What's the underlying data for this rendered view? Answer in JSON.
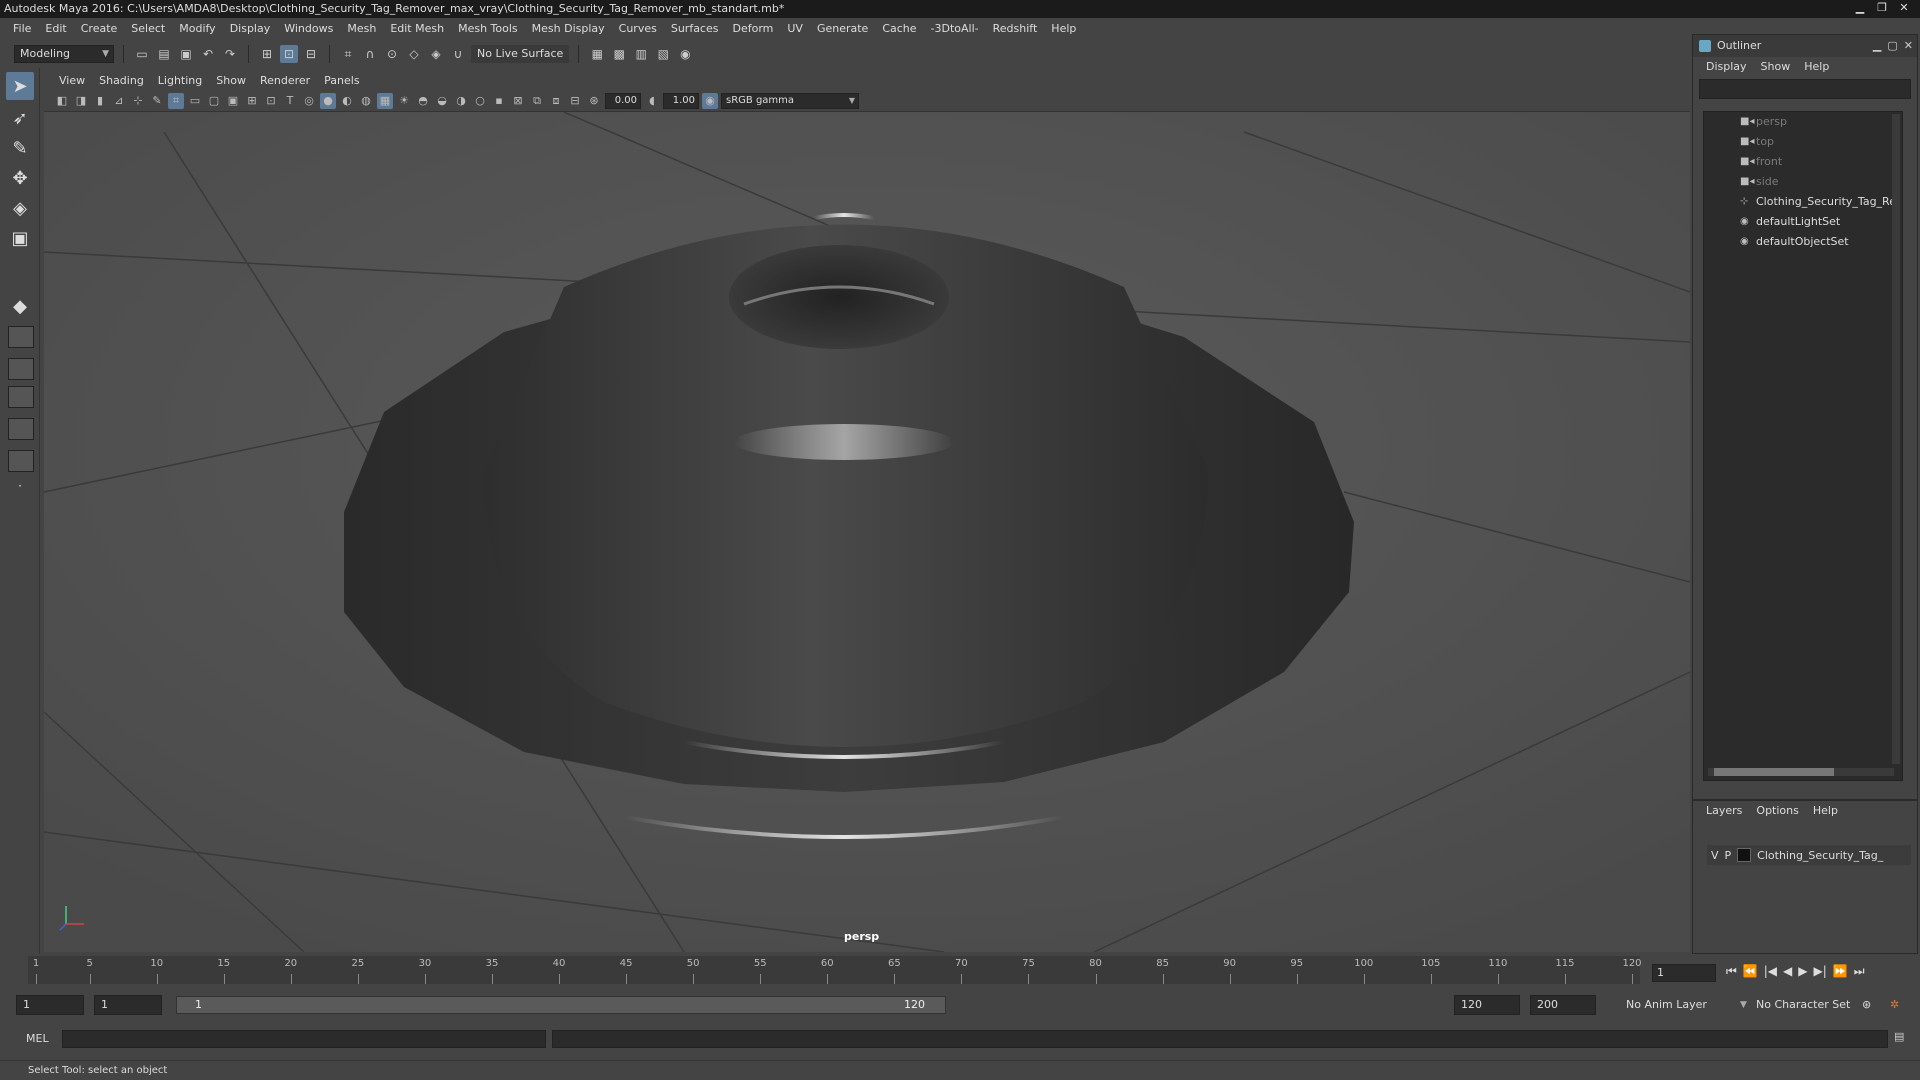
{
  "window": {
    "title": "Autodesk Maya 2016: C:\\Users\\AMDA8\\Desktop\\Clothing_Security_Tag_Remover_max_vray\\Clothing_Security_Tag_Remover_mb_standart.mb*"
  },
  "menubar": [
    "File",
    "Edit",
    "Create",
    "Select",
    "Modify",
    "Display",
    "Windows",
    "Mesh",
    "Edit Mesh",
    "Mesh Tools",
    "Mesh Display",
    "Curves",
    "Surfaces",
    "Deform",
    "UV",
    "Generate",
    "Cache",
    "-3DtoAll-",
    "Redshift",
    "Help"
  ],
  "shelf": {
    "mode": "Modeling",
    "live_surface": "No Live Surface"
  },
  "viewport": {
    "menu": [
      "View",
      "Shading",
      "Lighting",
      "Show",
      "Renderer",
      "Panels"
    ],
    "exposure": "0.00",
    "gamma_value": "1.00",
    "color_space": "sRGB gamma",
    "camera": "persp"
  },
  "outliner": {
    "title": "Outliner",
    "menu": [
      "Display",
      "Show",
      "Help"
    ],
    "items": [
      {
        "label": "persp",
        "kind": "camera"
      },
      {
        "label": "top",
        "kind": "camera"
      },
      {
        "label": "front",
        "kind": "camera"
      },
      {
        "label": "side",
        "kind": "camera"
      },
      {
        "label": "Clothing_Security_Tag_Re",
        "kind": "group"
      },
      {
        "label": "defaultLightSet",
        "kind": "set"
      },
      {
        "label": "defaultObjectSet",
        "kind": "set"
      }
    ]
  },
  "layers": {
    "menu": [
      "Layers",
      "Options",
      "Help"
    ],
    "row": {
      "v": "V",
      "p": "P",
      "name": "Clothing_Security_Tag_"
    }
  },
  "timeline": {
    "ticks": [
      "1",
      "5",
      "10",
      "15",
      "20",
      "25",
      "30",
      "35",
      "40",
      "45",
      "50",
      "55",
      "60",
      "65",
      "70",
      "75",
      "80",
      "85",
      "90",
      "95",
      "100",
      "105",
      "110",
      "115",
      "120"
    ],
    "current_frame": "1"
  },
  "range": {
    "start": "1",
    "playback_start": "1",
    "slider_start": "1",
    "slider_end": "120",
    "playback_end": "120",
    "end": "200",
    "anim_layer": "No Anim Layer",
    "character_set": "No Character Set"
  },
  "command": {
    "lang": "MEL"
  },
  "status": {
    "help": "Select Tool: select an object"
  }
}
